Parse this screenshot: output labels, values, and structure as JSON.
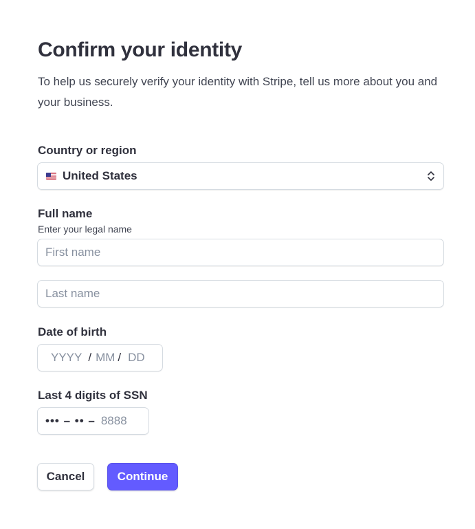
{
  "header": {
    "title": "Confirm your identity",
    "subtitle": "To help us securely verify your identity with Stripe, tell us more about you and your business."
  },
  "country": {
    "label": "Country or region",
    "selected": "United States",
    "flag_icon": "us-flag-icon"
  },
  "full_name": {
    "label": "Full name",
    "hint": "Enter your legal name",
    "first_placeholder": "First name",
    "last_placeholder": "Last name",
    "first_value": "",
    "last_value": ""
  },
  "dob": {
    "label": "Date of birth",
    "year_placeholder": "YYYY",
    "month_placeholder": "MM",
    "day_placeholder": "DD",
    "separator": "/"
  },
  "ssn": {
    "label": "Last 4 digits of SSN",
    "mask": "••• – •• –",
    "placeholder": "8888"
  },
  "actions": {
    "cancel_label": "Cancel",
    "continue_label": "Continue"
  },
  "colors": {
    "primary": "#635bff",
    "text": "#30313d",
    "placeholder": "#87909f",
    "border": "#d5dbe1"
  }
}
